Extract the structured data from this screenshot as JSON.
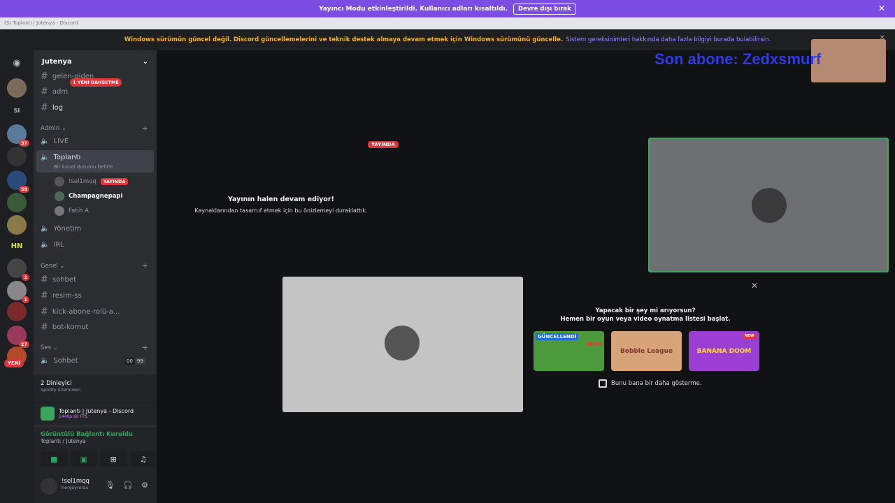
{
  "banner": {
    "text": "Yayıncı Modu etkinleştirildi. Kullanıcı adları kısaltıldı.",
    "button": "Devre dışı bırak"
  },
  "titlebar": "(3) Toplantı | Jutenya - Discord",
  "warning": {
    "text": "Windows sürümün güncel değil. Discord güncellemelerini ve teknik destek almaya devam etmek için Windows sürümünü güncelle.",
    "link": "Sistem gereksinimleri hakkında daha fazla bilgiyi burada bulabilirsin."
  },
  "guilds": {
    "si": "SI",
    "hn": "HN",
    "yeni": "YENİ",
    "badges": [
      "37",
      "58",
      "2",
      "1",
      "27"
    ]
  },
  "server": {
    "name": "Jutenya"
  },
  "channels": {
    "gelen": "gelen-giden",
    "adm": "adm",
    "log": "log",
    "mention": "1 YENİ BAHSETME",
    "cat_admin": "Admin",
    "live": "LIVE",
    "toplanti": "Toplantı",
    "toplanti_status": "Bir kanal durumu belirle",
    "u1": "!sel1mqq",
    "u1_live": "YAYINDA",
    "u2": "Champagnepapi",
    "u3": "Fatih A",
    "yonetim": "Yönetim",
    "irl": "IRL",
    "cat_genel": "Genel",
    "sohbet": "sohbet",
    "resim": "resim-ss",
    "kick": "kick-abone-rolü-a...",
    "bot": "bot-komut",
    "cat_ses": "Ses",
    "sohbet_v": "Sohbet",
    "sohbet_cnt": "00",
    "sohbet_lim": "99"
  },
  "spotify": {
    "title": "2 Dinleyici",
    "sub": "Spotify üzerinden"
  },
  "stream": {
    "title": "Toplantı | Jutenya - Discord",
    "sub": "1440p 60 FPS"
  },
  "conn": {
    "title": "Görüntülü Bağlantı Kuruldu",
    "sub": "Toplantı / Jutenya"
  },
  "user": {
    "name": "!sel1mqq",
    "status": "herşeyrelax"
  },
  "main": {
    "sonabone": "Son abone: Zedxsmurf",
    "live": "YAYINDA",
    "paused_title": "Yayının halen devam ediyor!",
    "paused_sub": "Kaynaklarından tasarruf etmek için bu önizlemeyi duraklattık.",
    "act_title": "Yapacak bir şey mi arıyorsun?",
    "act_sub": "Hemen bir oyun veya video oynatma listesi başlat.",
    "game1": "GÜNCELLENDİ",
    "game1_name": "FARM",
    "game2": "Bobble League",
    "game3": "BANANA DOOM",
    "game3_tag": "NEW",
    "dont_show": "Bunu bana bir daha gösterme."
  }
}
